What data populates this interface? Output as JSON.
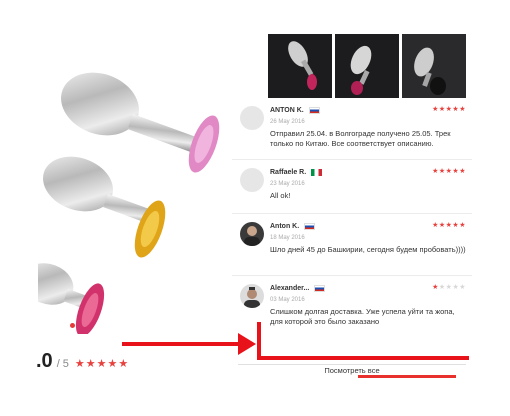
{
  "product": {
    "rating_value": ".0",
    "rating_total": "/ 5",
    "rating_stars": "★★★★★"
  },
  "reviews": [
    {
      "name": "ANTON K.",
      "flag": "ru",
      "stars": "★★★★★",
      "stars_off": "",
      "date": "26 May 2016",
      "text": "Отправил 25.04. в Волгограде получено 25.05. Трек только по Китаю. Все соответствует описанию."
    },
    {
      "name": "Raffaele R.",
      "flag": "it",
      "stars": "★★★★★",
      "stars_off": "",
      "date": "23 May 2016",
      "text": "All ok!"
    },
    {
      "name": "Anton K.",
      "flag": "ru",
      "stars": "★★★★★",
      "stars_off": "",
      "date": "18 May 2016",
      "text": "Шло дней 45 до Башкирии, сегодня будем пробовать))))"
    },
    {
      "name": "Alexander...",
      "flag": "ru",
      "stars": "★",
      "stars_off": "★★★★",
      "date": "03 May 2016",
      "text": "Слишком долгая доставка. Уже успела уйти та жопа, для которой это было заказано"
    }
  ],
  "show_all_label": "Посмотреть все",
  "colors": {
    "accent_red": "#e8423f",
    "annotation_red": "#e8131a"
  }
}
